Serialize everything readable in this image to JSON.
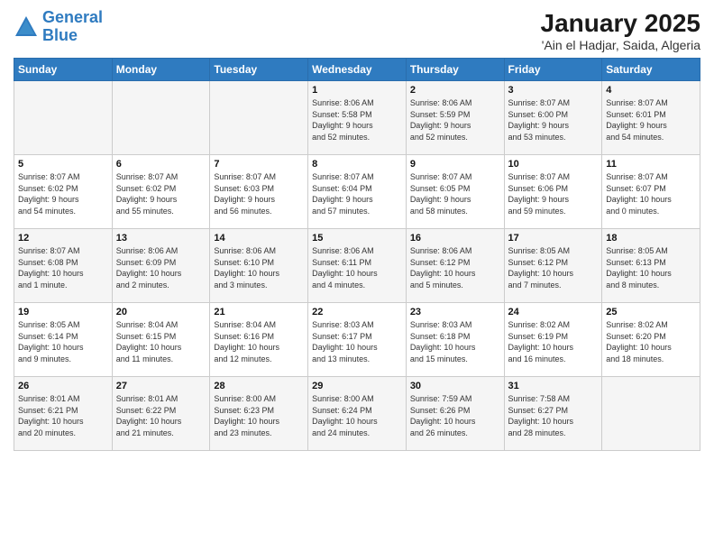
{
  "header": {
    "logo_line1": "General",
    "logo_line2": "Blue",
    "title": "January 2025",
    "subtitle": "'Ain el Hadjar, Saida, Algeria"
  },
  "weekdays": [
    "Sunday",
    "Monday",
    "Tuesday",
    "Wednesday",
    "Thursday",
    "Friday",
    "Saturday"
  ],
  "weeks": [
    [
      {
        "day": "",
        "info": ""
      },
      {
        "day": "",
        "info": ""
      },
      {
        "day": "",
        "info": ""
      },
      {
        "day": "1",
        "info": "Sunrise: 8:06 AM\nSunset: 5:58 PM\nDaylight: 9 hours\nand 52 minutes."
      },
      {
        "day": "2",
        "info": "Sunrise: 8:06 AM\nSunset: 5:59 PM\nDaylight: 9 hours\nand 52 minutes."
      },
      {
        "day": "3",
        "info": "Sunrise: 8:07 AM\nSunset: 6:00 PM\nDaylight: 9 hours\nand 53 minutes."
      },
      {
        "day": "4",
        "info": "Sunrise: 8:07 AM\nSunset: 6:01 PM\nDaylight: 9 hours\nand 54 minutes."
      }
    ],
    [
      {
        "day": "5",
        "info": "Sunrise: 8:07 AM\nSunset: 6:02 PM\nDaylight: 9 hours\nand 54 minutes."
      },
      {
        "day": "6",
        "info": "Sunrise: 8:07 AM\nSunset: 6:02 PM\nDaylight: 9 hours\nand 55 minutes."
      },
      {
        "day": "7",
        "info": "Sunrise: 8:07 AM\nSunset: 6:03 PM\nDaylight: 9 hours\nand 56 minutes."
      },
      {
        "day": "8",
        "info": "Sunrise: 8:07 AM\nSunset: 6:04 PM\nDaylight: 9 hours\nand 57 minutes."
      },
      {
        "day": "9",
        "info": "Sunrise: 8:07 AM\nSunset: 6:05 PM\nDaylight: 9 hours\nand 58 minutes."
      },
      {
        "day": "10",
        "info": "Sunrise: 8:07 AM\nSunset: 6:06 PM\nDaylight: 9 hours\nand 59 minutes."
      },
      {
        "day": "11",
        "info": "Sunrise: 8:07 AM\nSunset: 6:07 PM\nDaylight: 10 hours\nand 0 minutes."
      }
    ],
    [
      {
        "day": "12",
        "info": "Sunrise: 8:07 AM\nSunset: 6:08 PM\nDaylight: 10 hours\nand 1 minute."
      },
      {
        "day": "13",
        "info": "Sunrise: 8:06 AM\nSunset: 6:09 PM\nDaylight: 10 hours\nand 2 minutes."
      },
      {
        "day": "14",
        "info": "Sunrise: 8:06 AM\nSunset: 6:10 PM\nDaylight: 10 hours\nand 3 minutes."
      },
      {
        "day": "15",
        "info": "Sunrise: 8:06 AM\nSunset: 6:11 PM\nDaylight: 10 hours\nand 4 minutes."
      },
      {
        "day": "16",
        "info": "Sunrise: 8:06 AM\nSunset: 6:12 PM\nDaylight: 10 hours\nand 5 minutes."
      },
      {
        "day": "17",
        "info": "Sunrise: 8:05 AM\nSunset: 6:12 PM\nDaylight: 10 hours\nand 7 minutes."
      },
      {
        "day": "18",
        "info": "Sunrise: 8:05 AM\nSunset: 6:13 PM\nDaylight: 10 hours\nand 8 minutes."
      }
    ],
    [
      {
        "day": "19",
        "info": "Sunrise: 8:05 AM\nSunset: 6:14 PM\nDaylight: 10 hours\nand 9 minutes."
      },
      {
        "day": "20",
        "info": "Sunrise: 8:04 AM\nSunset: 6:15 PM\nDaylight: 10 hours\nand 11 minutes."
      },
      {
        "day": "21",
        "info": "Sunrise: 8:04 AM\nSunset: 6:16 PM\nDaylight: 10 hours\nand 12 minutes."
      },
      {
        "day": "22",
        "info": "Sunrise: 8:03 AM\nSunset: 6:17 PM\nDaylight: 10 hours\nand 13 minutes."
      },
      {
        "day": "23",
        "info": "Sunrise: 8:03 AM\nSunset: 6:18 PM\nDaylight: 10 hours\nand 15 minutes."
      },
      {
        "day": "24",
        "info": "Sunrise: 8:02 AM\nSunset: 6:19 PM\nDaylight: 10 hours\nand 16 minutes."
      },
      {
        "day": "25",
        "info": "Sunrise: 8:02 AM\nSunset: 6:20 PM\nDaylight: 10 hours\nand 18 minutes."
      }
    ],
    [
      {
        "day": "26",
        "info": "Sunrise: 8:01 AM\nSunset: 6:21 PM\nDaylight: 10 hours\nand 20 minutes."
      },
      {
        "day": "27",
        "info": "Sunrise: 8:01 AM\nSunset: 6:22 PM\nDaylight: 10 hours\nand 21 minutes."
      },
      {
        "day": "28",
        "info": "Sunrise: 8:00 AM\nSunset: 6:23 PM\nDaylight: 10 hours\nand 23 minutes."
      },
      {
        "day": "29",
        "info": "Sunrise: 8:00 AM\nSunset: 6:24 PM\nDaylight: 10 hours\nand 24 minutes."
      },
      {
        "day": "30",
        "info": "Sunrise: 7:59 AM\nSunset: 6:26 PM\nDaylight: 10 hours\nand 26 minutes."
      },
      {
        "day": "31",
        "info": "Sunrise: 7:58 AM\nSunset: 6:27 PM\nDaylight: 10 hours\nand 28 minutes."
      },
      {
        "day": "",
        "info": ""
      }
    ]
  ]
}
